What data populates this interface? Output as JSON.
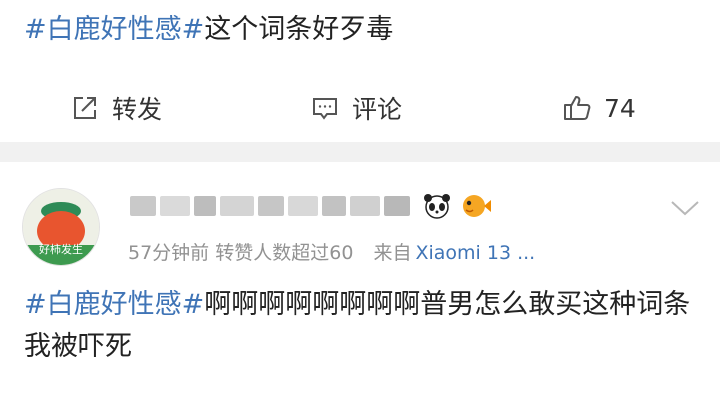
{
  "post1": {
    "hashtag": "#白鹿好性感#",
    "text": "这个词条好歹毒"
  },
  "actions": {
    "repost": {
      "icon": "repost-icon",
      "label": "转发"
    },
    "comment": {
      "icon": "comment-icon",
      "label": "评论"
    },
    "like": {
      "icon": "thumbs-up-icon",
      "count": "74"
    }
  },
  "post2": {
    "avatar_text": "好柿发生",
    "emoji_badges": [
      "panda-icon",
      "pufferfish-icon"
    ],
    "meta": {
      "time": "57分钟前",
      "likes_note": "转赞人数超过60",
      "source_prefix": "来自",
      "source_device": "Xiaomi 13 ..."
    },
    "hashtag": "#白鹿好性感#",
    "text": "啊啊啊啊啊啊啊啊普男怎么敢买这种词条我被吓死"
  },
  "colors": {
    "link_blue": "#3f74b6",
    "text_dark": "#222222",
    "meta_gray": "#929292",
    "separator_gray": "#f1f1f1"
  }
}
